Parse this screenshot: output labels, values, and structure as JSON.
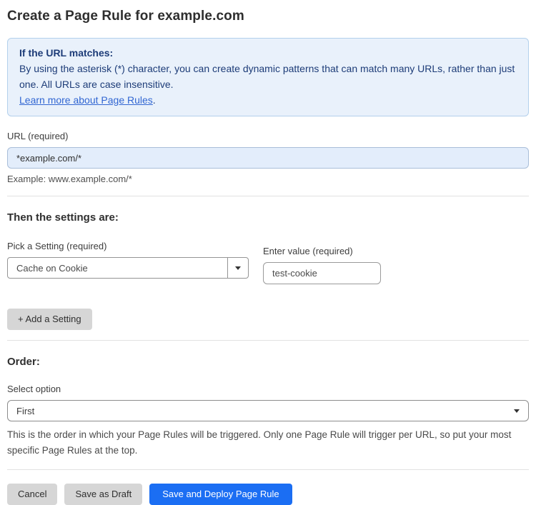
{
  "page": {
    "title": "Create a Page Rule for example.com"
  },
  "info_box": {
    "heading": "If the URL matches:",
    "body": "By using the asterisk (*) character, you can create dynamic patterns that can match many URLs, rather than just one. All URLs are case insensitive.",
    "link_label": "Learn more about Page Rules",
    "link_suffix": "."
  },
  "url_field": {
    "label": "URL (required)",
    "value": "*example.com/*",
    "helper": "Example: www.example.com/*"
  },
  "settings": {
    "heading": "Then the settings are:",
    "setting_label": "Pick a Setting (required)",
    "setting_value": "Cache on Cookie",
    "value_label": "Enter value (required)",
    "value_text": "test-cookie",
    "add_button_label": "+ Add a Setting"
  },
  "order": {
    "heading": "Order:",
    "select_label": "Select option",
    "selected_option": "First",
    "helper": "This is the order in which your Page Rules will be triggered. Only one Page Rule will trigger per URL, so put your most specific Page Rules at the top."
  },
  "footer": {
    "cancel_label": "Cancel",
    "save_draft_label": "Save as Draft",
    "save_deploy_label": "Save and Deploy Page Rule"
  },
  "icons": {
    "setting_dropdown": "triangle-down-icon",
    "order_dropdown": "triangle-down-icon"
  },
  "colors": {
    "info_bg": "#e9f1fb",
    "info_border": "#b3d0ec",
    "info_text": "#1d3c78",
    "link_blue": "#3166d2",
    "url_input_bg": "#e3edfb",
    "primary_button": "#1b6ef3"
  }
}
